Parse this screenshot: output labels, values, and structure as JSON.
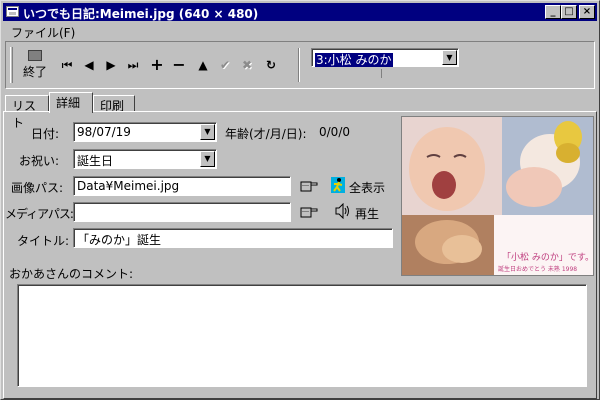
{
  "window": {
    "title": "いつでも日記:Meimei.jpg (640 × 480)"
  },
  "menu": {
    "file": "ファイル(F)"
  },
  "toolbar": {
    "exit_label": "終了",
    "nav_first": "⏮",
    "nav_prev": "◀",
    "nav_next": "▶",
    "nav_last": "⏭",
    "add": "+",
    "remove": "−",
    "up": "▲",
    "check": "✔",
    "cancel": "✖",
    "refresh": "↻",
    "selector_value": "3:小松 みのか"
  },
  "tabs": [
    "リスト",
    "詳細",
    "印刷"
  ],
  "form": {
    "date_label": "日付:",
    "date_value": "98/07/19",
    "age_label": "年齢(才/月/日):",
    "age_value": "0/0/0",
    "celebration_label": "お祝い:",
    "celebration_value": "誕生日",
    "image_path_label": "画像パス:",
    "image_path_value": "Data¥Meimei.jpg",
    "fullscreen_label": "全表示",
    "media_path_label": "メディアパス:",
    "media_path_value": "",
    "play_label": "再生",
    "title_label": "タイトル:",
    "title_value": "「みのか」誕生",
    "comment_label": "おかあさんのコメント:",
    "comment_value": ""
  },
  "photo": {
    "caption_main": "「小松 みのか」です。",
    "caption_sub": "誕生日おめでとう 未熟 1998"
  },
  "colors": {
    "titlebar": "#000080",
    "face": "#c0c0c0",
    "selection": "#000080"
  }
}
